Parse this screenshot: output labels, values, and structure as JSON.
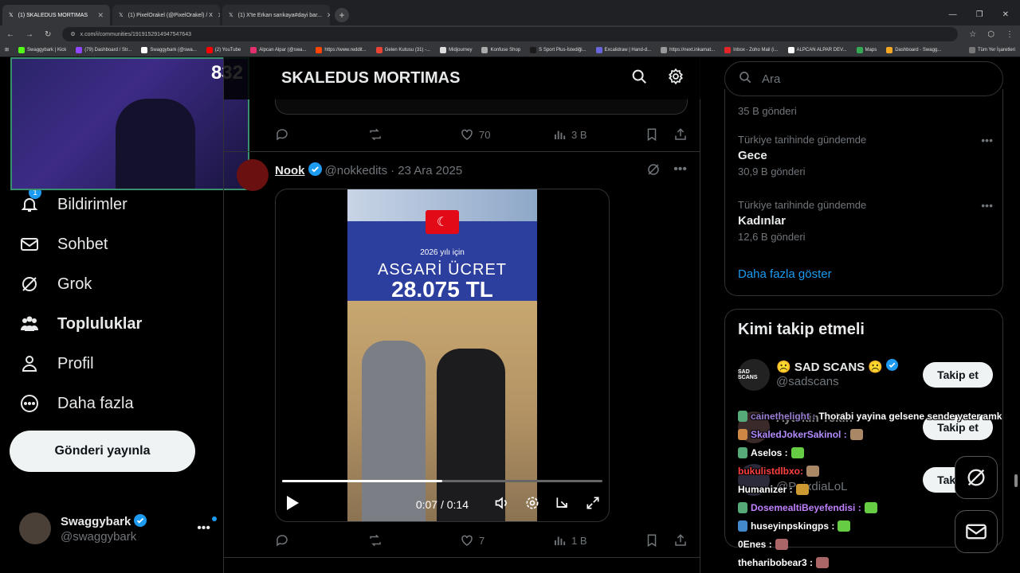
{
  "browser": {
    "tabs": [
      {
        "label": "(1) SKALEDUS MORTIMAS"
      },
      {
        "label": "(1) PixelOrakel (@PixelOrakel) / X"
      },
      {
        "label": "(1) X'te Erkan sarıkaya#dayi bar..."
      }
    ],
    "url": "x.com/i/communities/1919152914947547643",
    "bookmarks": [
      "Swaggybark | Kick",
      "(79) Dashboard / Str...",
      "Swaggybark (@swa...",
      "(2) YouTube",
      "Alpcan Alpar (@swa...",
      "https://www.reddit...",
      "Gelen Kutusu (31) -...",
      "Midjourney",
      "Konfuse Shop",
      "S Sport Plus-İstediği...",
      "Excalidraw | Hand-d...",
      "https://next.inkamat...",
      "Inbox - Zoho Mail (i...",
      "ALPCAN ALPAR DEV...",
      "Maps",
      "Dashboard - Swagg..."
    ],
    "bookmarks_right": "Tüm Yer İşaretleri"
  },
  "webcam": {
    "viewers": "832"
  },
  "nav": {
    "notifications": "Bildirimler",
    "notifications_badge": "1",
    "chat": "Sohbet",
    "grok": "Grok",
    "communities": "Topluluklar",
    "profile": "Profil",
    "more": "Daha fazla",
    "post_button": "Gönderi yayınla"
  },
  "account": {
    "name": "Swaggybark",
    "handle": "@swaggybark"
  },
  "main": {
    "title": "SKALEDUS MORTIMAS",
    "prev_actions": {
      "likes": "70",
      "views": "3 B"
    },
    "tweet": {
      "name": "Nook",
      "handle": "@nokkedits",
      "date": "· 23 Ara 2025",
      "video": {
        "year_text": "2026 yılı için",
        "headline": "ASGARİ ÜCRET",
        "amount": "28.075 TL",
        "time": "0:07 / 0:14",
        "progress": 0.5
      },
      "actions": {
        "likes": "7",
        "views": "1 B"
      }
    }
  },
  "right": {
    "search_placeholder": "Ara",
    "trends": [
      {
        "category": "",
        "name": "",
        "count": "35 B gönderi"
      },
      {
        "category": "Türkiye tarihinde gündemde",
        "name": "Gece",
        "count": "30,9 B gönderi"
      },
      {
        "category": "Türkiye tarihinde gündemde",
        "name": "Kadınlar",
        "count": "12,6 B gönderi"
      }
    ],
    "show_more": "Daha fazla göster",
    "who_to_follow": {
      "title": "Kimi takip etmeli",
      "accounts": [
        {
          "name": "☹️ SAD SCANS ☹️",
          "handle": "@sadscans",
          "avatar_text": "SAD SCANS",
          "button": "Takip et"
        },
        {
          "name": "Aytekin Tekin",
          "handle": "",
          "button": "Takip et"
        },
        {
          "name": "",
          "handle": "@PaixdiaLoL",
          "button": "Takip et"
        }
      ]
    }
  },
  "chat": [
    {
      "user": "cainethelight :",
      "msg": "Thorabi yayina gelsene sende yeter amk",
      "color": "#9b7fd4"
    },
    {
      "user": "SkaledJokerSakinol :",
      "msg": "",
      "color": "#b48cff"
    },
    {
      "user": "Aselos :",
      "msg": "",
      "color": "#ffffff"
    },
    {
      "user": "bukulistdlbxo:",
      "msg": "",
      "color": "#ff4040"
    },
    {
      "user": "Humanizer :",
      "msg": "",
      "color": "#ffffff"
    },
    {
      "user": "DosemealtiBeyefendisi :",
      "msg": "",
      "color": "#c080ff"
    },
    {
      "user": "huseyinpskingps :",
      "msg": "",
      "color": "#ffffff"
    },
    {
      "user": "0Enes :",
      "msg": "",
      "color": "#ffffff"
    },
    {
      "user": "theharibobear3 :",
      "msg": "",
      "color": "#ffffff"
    }
  ]
}
